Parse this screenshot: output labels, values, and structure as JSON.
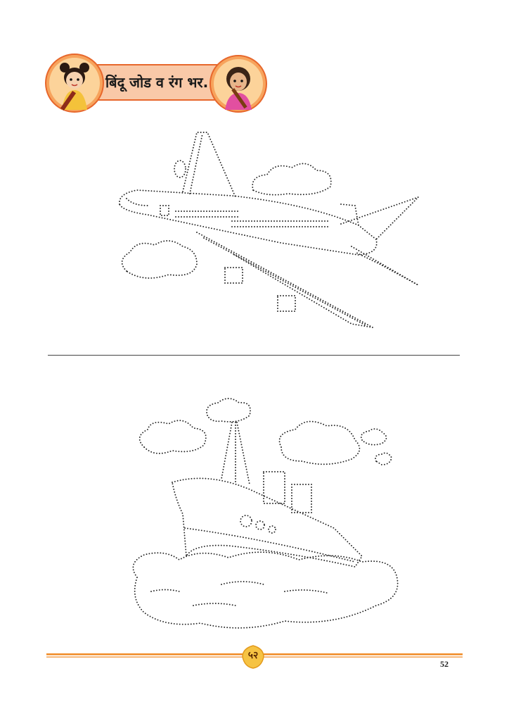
{
  "header": {
    "title": "बिंदू जोड व रंग भर."
  },
  "footer": {
    "page_badge": "५२",
    "page_number": "52"
  },
  "colors": {
    "banner_fill": "#f9c9a8",
    "banner_border": "#e7672c",
    "footer_orange": "#f08a24",
    "badge_yellow": "#f6c343"
  },
  "icons": {
    "left_avatar": "girl-with-paintbrush-avatar",
    "right_avatar": "girl-with-paintbrush-avatar",
    "plane": "dotted-airplane-drawing",
    "ship": "dotted-ship-drawing"
  }
}
